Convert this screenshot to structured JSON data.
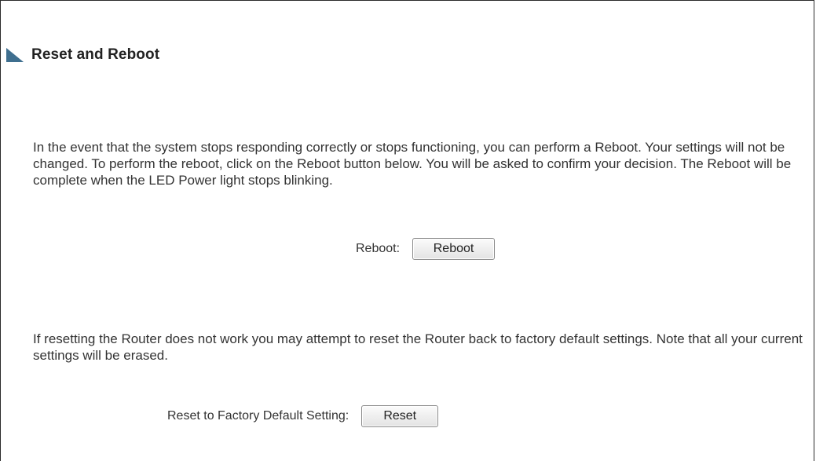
{
  "page": {
    "title": "Reset and Reboot"
  },
  "reboot_section": {
    "description": "In the event that the system stops responding correctly or stops functioning, you can perform a Reboot. Your settings will not be changed. To perform the reboot, click on the Reboot button below. You will be asked to confirm your decision. The Reboot will be complete when the LED Power light stops blinking.",
    "label": "Reboot:",
    "button_label": "Reboot"
  },
  "reset_section": {
    "description": "If resetting the Router does not work you may attempt to reset the Router back to factory default settings. Note that all your current settings will be erased.",
    "label": "Reset to Factory Default Setting:",
    "button_label": "Reset"
  },
  "icons": {
    "title_marker": "triangle-arrow-icon"
  },
  "colors": {
    "title_marker": "#3f6f8f",
    "text": "#333333"
  }
}
